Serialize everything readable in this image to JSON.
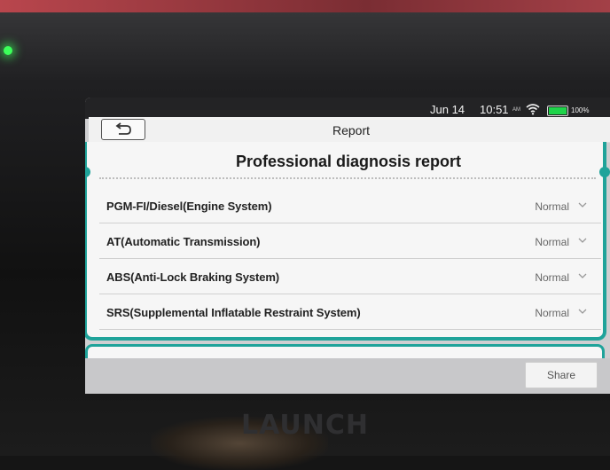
{
  "device": {
    "brand": "LAUNCH"
  },
  "status_bar": {
    "date": "Jun 14",
    "time": "10:51",
    "ampm": "AM",
    "battery": "100%",
    "battery_level": 1.0,
    "battery_color": "#1fd44a",
    "wifi_icon": "wifi-icon"
  },
  "header": {
    "back_icon": "back-arrow-icon",
    "title": "Report"
  },
  "report": {
    "heading": "Professional diagnosis report",
    "accent_color": "#1fa39a",
    "systems": [
      {
        "name": "PGM-FI/Diesel(Engine System)",
        "status": "Normal"
      },
      {
        "name": "AT(Automatic Transmission)",
        "status": "Normal"
      },
      {
        "name": "ABS(Anti-Lock Braking System)",
        "status": "Normal"
      },
      {
        "name": "SRS(Supplemental Inflatable Restraint System)",
        "status": "Normal"
      }
    ]
  },
  "footer": {
    "share_label": "Share"
  }
}
